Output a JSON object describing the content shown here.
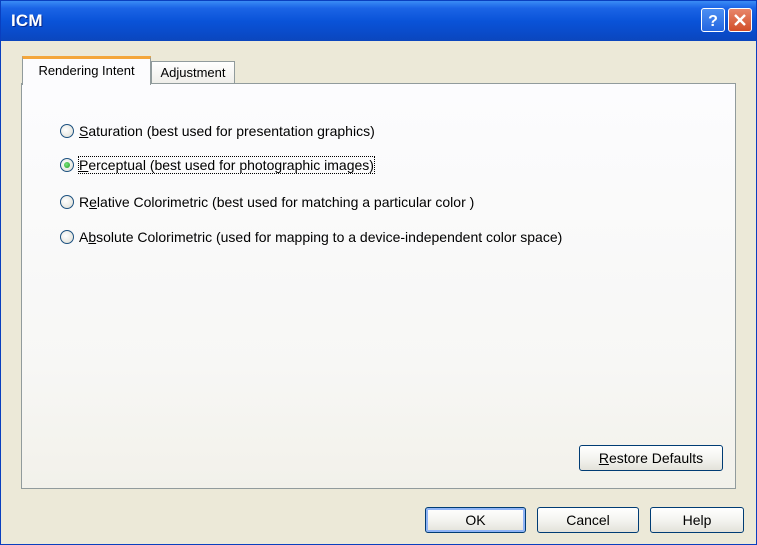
{
  "window": {
    "title": "ICM"
  },
  "titlebar_buttons": {
    "help": "?",
    "close": "×"
  },
  "tabs": [
    {
      "label": "Rendering Intent",
      "active": true
    },
    {
      "label": "Adjustment",
      "active": false
    }
  ],
  "options": [
    {
      "mnemonic": "S",
      "rest": "aturation (best used for presentation graphics)",
      "checked": false
    },
    {
      "mnemonic": "P",
      "rest": "erceptual (best used for photographic images)",
      "checked": true
    },
    {
      "prefix": "R",
      "mnemonic": "e",
      "rest": "lative Colorimetric (best used for matching a particular color )",
      "checked": false
    },
    {
      "prefix": "A",
      "mnemonic": "b",
      "rest": "solute Colorimetric (used for mapping to a device-independent color space)",
      "checked": false
    }
  ],
  "restore": {
    "mnemonic": "R",
    "rest": "estore Defaults"
  },
  "buttons": {
    "ok": "OK",
    "cancel": "Cancel",
    "help": "Help"
  }
}
